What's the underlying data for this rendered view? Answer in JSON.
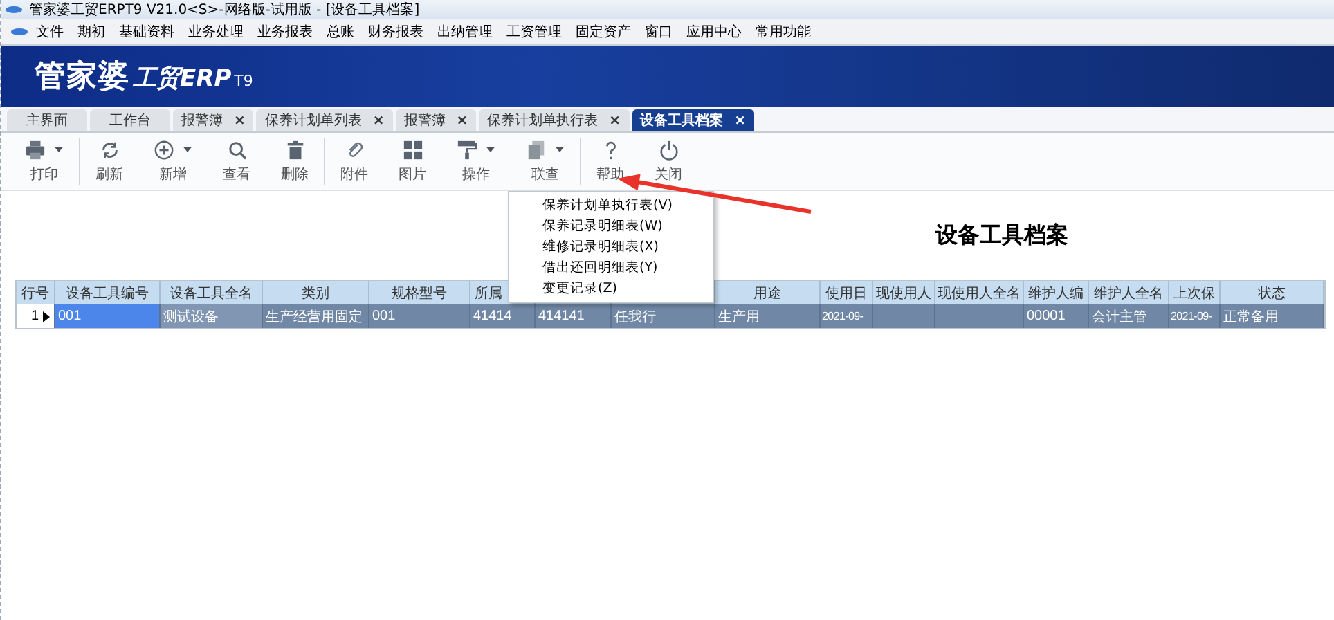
{
  "window": {
    "title": "管家婆工贸ERPT9 V21.0<S>-网络版-试用版 - [设备工具档案]"
  },
  "menu_bar": [
    "文件",
    "期初",
    "基础资料",
    "业务处理",
    "业务报表",
    "总账",
    "财务报表",
    "出纳管理",
    "工资管理",
    "固定资产",
    "窗口",
    "应用中心",
    "常用功能"
  ],
  "banner": {
    "brand": "管家婆",
    "product": "工贸ERP",
    "version": "T9"
  },
  "tabs": [
    {
      "label": "主界面",
      "selected": false,
      "closable": false
    },
    {
      "label": "工作台",
      "selected": false,
      "closable": false
    },
    {
      "label": "报警簿",
      "selected": false,
      "closable": true
    },
    {
      "label": "保养计划单列表",
      "selected": false,
      "closable": true
    },
    {
      "label": "报警簿",
      "selected": false,
      "closable": true
    },
    {
      "label": "保养计划单执行表",
      "selected": false,
      "closable": true
    },
    {
      "label": "设备工具档案",
      "selected": true,
      "closable": true
    }
  ],
  "tab_close": "×",
  "toolbar": [
    {
      "kind": "print",
      "label": "打印",
      "dropdown": true,
      "group_end": true
    },
    {
      "kind": "refresh",
      "label": "刷新",
      "dropdown": false,
      "group_end": false
    },
    {
      "kind": "add",
      "label": "新增",
      "dropdown": true,
      "group_end": false
    },
    {
      "kind": "search",
      "label": "查看",
      "dropdown": false,
      "group_end": false
    },
    {
      "kind": "delete",
      "label": "删除",
      "dropdown": false,
      "group_end": true
    },
    {
      "kind": "attach",
      "label": "附件",
      "dropdown": false,
      "group_end": false
    },
    {
      "kind": "picture",
      "label": "图片",
      "dropdown": false,
      "group_end": false
    },
    {
      "kind": "operate",
      "label": "操作",
      "dropdown": true,
      "group_end": false
    },
    {
      "kind": "link",
      "label": "联查",
      "dropdown": true,
      "group_end": true
    },
    {
      "kind": "help",
      "label": "帮助",
      "dropdown": false,
      "group_end": false
    },
    {
      "kind": "close",
      "label": "关闭",
      "dropdown": false,
      "group_end": false
    }
  ],
  "dropdown_menu": [
    "保养计划单执行表(V)",
    "保养记录明细表(W)",
    "维修记录明细表(X)",
    "借出还回明细表(Y)",
    "变更记录(Z)"
  ],
  "page_title": "设备工具档案",
  "table": {
    "columns": [
      "行号",
      "设备工具编号",
      "设备工具全名",
      "类别",
      "规格型号",
      "所属",
      "",
      "",
      "用途",
      "使用日",
      "现使用人",
      "现使用人全名",
      "维护人编",
      "维护人全名",
      "上次保",
      "状态"
    ],
    "rows": [
      {
        "selected": true,
        "cells": [
          "1",
          "001",
          "测试设备",
          "生产经营用固定",
          "001",
          "41414",
          "414141",
          "任我行",
          "生产用",
          "2021-09-",
          "",
          "",
          "00001",
          "会计主管",
          "2021-09-",
          "正常备用"
        ]
      }
    ]
  }
}
